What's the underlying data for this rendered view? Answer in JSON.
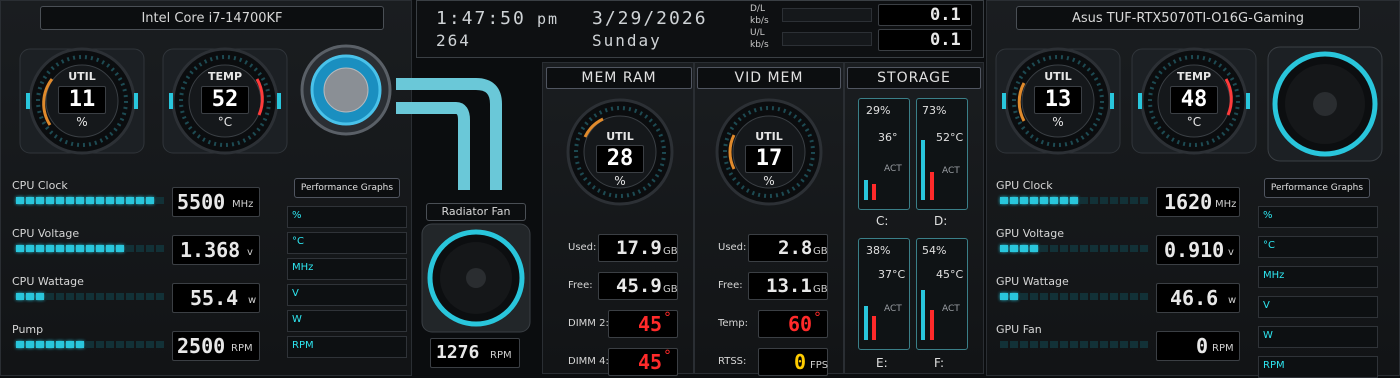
{
  "cpu": {
    "title": "Intel Core i7-14700KF",
    "util": {
      "label": "UTIL",
      "value": "11",
      "unit": "%"
    },
    "temp": {
      "label": "TEMP",
      "value": "52",
      "unit": "°C"
    },
    "metrics": [
      {
        "label": "CPU Clock",
        "value": "5500",
        "unit": "MHz",
        "level": 0.92
      },
      {
        "label": "CPU Voltage",
        "value": "1.368",
        "unit": "v",
        "level": 0.7
      },
      {
        "label": "CPU Wattage",
        "value": "55.4",
        "unit": "w",
        "level": 0.18
      },
      {
        "label": "Pump",
        "value": "2500",
        "unit": "RPM",
        "level": 0.45
      }
    ],
    "graphs_button": "Performance Graphs",
    "graph_items": [
      "%",
      "°C",
      "MHz",
      "V",
      "W",
      "RPM"
    ],
    "radiator_label": "Radiator Fan",
    "radiator_value": "1276",
    "radiator_unit": "RPM"
  },
  "top": {
    "time": "1:47:50",
    "ampm": "pm",
    "date": "3/29/2026",
    "number": "264",
    "day": "Sunday",
    "dl_label": "D/L",
    "ul_label": "U/L",
    "rate_unit": "kb/s",
    "dl_value": "0.1",
    "ul_value": "0.1"
  },
  "mem": {
    "title": "MEM RAM",
    "util": {
      "label": "UTIL",
      "value": "28",
      "unit": "%"
    },
    "rows": [
      {
        "label": "Used:",
        "value": "17.9",
        "unit": "GB",
        "color": "#e8e8e8"
      },
      {
        "label": "Free:",
        "value": "45.9",
        "unit": "GB",
        "color": "#e8e8e8"
      },
      {
        "label": "DIMM 2:",
        "value": "45",
        "unit": "°",
        "color": "#ff2a2a"
      },
      {
        "label": "DIMM 4:",
        "value": "45",
        "unit": "°",
        "color": "#ff2a2a"
      }
    ]
  },
  "vid": {
    "title": "VID MEM",
    "util": {
      "label": "UTIL",
      "value": "17",
      "unit": "%"
    },
    "rows": [
      {
        "label": "Used:",
        "value": "2.8",
        "unit": "GB",
        "color": "#e8e8e8"
      },
      {
        "label": "Free:",
        "value": "13.1",
        "unit": "GB",
        "color": "#e8e8e8"
      },
      {
        "label": "Temp:",
        "value": "60",
        "unit": "°",
        "color": "#ff2a2a"
      },
      {
        "label": "RTSS:",
        "value": "0",
        "unit": "FPS",
        "color": "#ffcc00"
      }
    ]
  },
  "storage": {
    "title": "STORAGE",
    "drives": [
      {
        "letter": "C:",
        "usage": "29%",
        "temp": "36°",
        "act": "ACT",
        "level": 0.29
      },
      {
        "letter": "D:",
        "usage": "73%",
        "temp": "52°C",
        "act": "ACT",
        "level": 0.73
      },
      {
        "letter": "E:",
        "usage": "38%",
        "temp": "37°C",
        "act": "ACT",
        "level": 0.38
      },
      {
        "letter": "F:",
        "usage": "54%",
        "temp": "45°C",
        "act": "ACT",
        "level": 0.54
      }
    ]
  },
  "gpu": {
    "title": "Asus TUF-RTX5070TI-O16G-Gaming",
    "util": {
      "label": "UTIL",
      "value": "13",
      "unit": "%"
    },
    "temp": {
      "label": "TEMP",
      "value": "48",
      "unit": "°C"
    },
    "metrics": [
      {
        "label": "GPU Clock",
        "value": "1620",
        "unit": "MHz",
        "level": 0.55
      },
      {
        "label": "GPU Voltage",
        "value": "0.910",
        "unit": "v",
        "level": 0.3
      },
      {
        "label": "GPU Wattage",
        "value": "46.6",
        "unit": "w",
        "level": 0.12
      },
      {
        "label": "GPU Fan",
        "value": "0",
        "unit": "RPM",
        "level": 0.0
      }
    ],
    "graphs_button": "Performance Graphs",
    "graph_items": [
      "%",
      "°C",
      "MHz",
      "V",
      "W",
      "RPM"
    ]
  },
  "colors": {
    "accent": "#29c6dc",
    "alert": "#ff2a2a",
    "fps": "#ffcc00"
  }
}
